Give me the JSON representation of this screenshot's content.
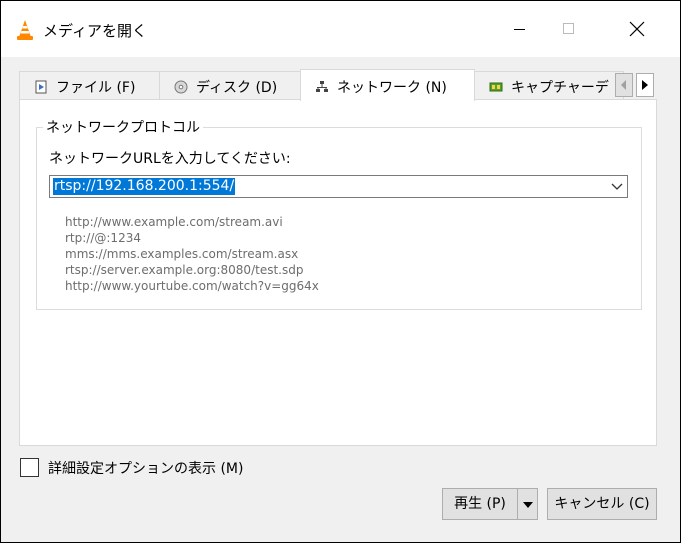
{
  "window": {
    "title": "メディアを開く",
    "icon": "vlc-cone-icon"
  },
  "tabs": [
    {
      "label": "ファイル (F)",
      "icon": "file-icon",
      "active": false
    },
    {
      "label": "ディスク (D)",
      "icon": "disc-icon",
      "active": false
    },
    {
      "label": "ネットワーク (N)",
      "icon": "network-icon",
      "active": true
    },
    {
      "label": "キャプチャーデ",
      "icon": "capture-card-icon",
      "active": false
    }
  ],
  "network": {
    "group_title": "ネットワークプロトコル",
    "url_label": "ネットワークURLを入力してください:",
    "url_value": "rtsp://192.168.200.1:554/",
    "examples": [
      "http://www.example.com/stream.avi",
      "rtp://@:1234",
      "mms://mms.examples.com/stream.asx",
      "rtsp://server.example.org:8080/test.sdp",
      "http://www.yourtube.com/watch?v=gg64x"
    ]
  },
  "options": {
    "advanced_label": "詳細設定オプションの表示 (M)",
    "advanced_checked": false
  },
  "buttons": {
    "play_label": "再生 (P)",
    "cancel_label": "キャンセル (C)"
  },
  "colors": {
    "selection": "#0078d7",
    "window_bg": "#f0f0f0",
    "vlc_orange": "#ff8800"
  }
}
